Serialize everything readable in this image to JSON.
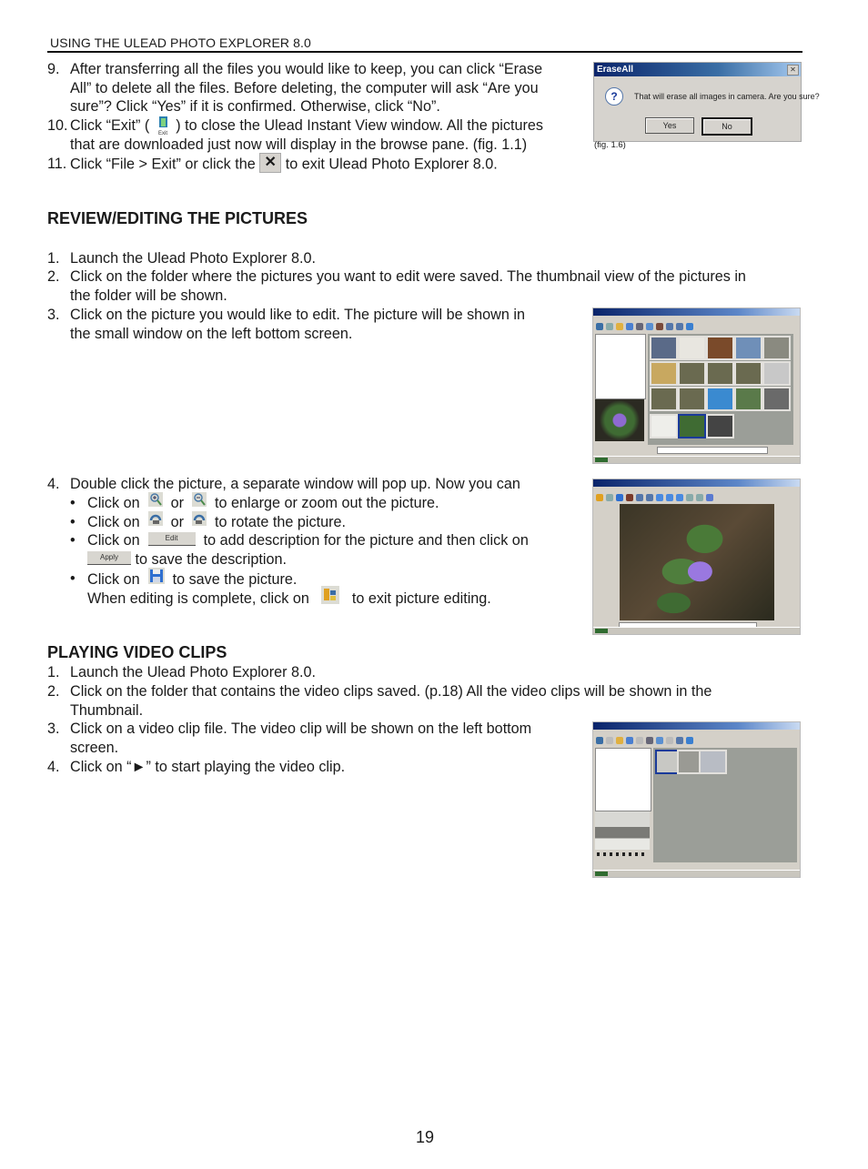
{
  "header": {
    "title": "USING THE ULEAD PHOTO EXPLORER 8.0"
  },
  "top_steps": [
    {
      "num": "9.",
      "lines": [
        "After transferring all the files you would like to keep, you can click “Erase",
        "All” to delete all the files. Before deleting, the computer will ask “Are you",
        "sure”?  Click “Yes” if it is confirmed. Otherwise, click “No”."
      ]
    },
    {
      "num": "10.",
      "line1_before": "Click “Exit” (",
      "line1_after": ") to close the Ulead Instant View window. All the pictures",
      "line2": "that are downloaded just now will display in the browse pane. (fig. 1.1)",
      "icon": "exit-icon",
      "icon_label": "Exit"
    },
    {
      "num": "11.",
      "before": "Click “File > Exit” or click the",
      "after": "to exit Ulead Photo Explorer 8.0.",
      "icon": "close-x-icon"
    }
  ],
  "erase_dialog": {
    "title": "EraseAll",
    "message": "That will erase all images in camera. Are you sure?",
    "yes_label": "Yes",
    "no_label": "No",
    "caption": "(fig. 1.6)"
  },
  "review_section": {
    "heading": "REVIEW/EDITING THE PICTURES",
    "steps": [
      {
        "num": "1.",
        "lines": [
          "Launch the Ulead Photo Explorer 8.0."
        ]
      },
      {
        "num": "2.",
        "lines": [
          "Click on the folder where the pictures you want to edit were saved. The thumbnail view of the pictures in",
          "the folder will be shown."
        ]
      },
      {
        "num": "3.",
        "lines": [
          "Click on the picture you would like to edit. The picture will be shown in",
          "the small window on the left bottom screen."
        ]
      },
      {
        "num": "4.",
        "lines": [
          "Double click the picture, a separate window will pop up. Now you can"
        ]
      }
    ],
    "bullets": [
      {
        "prefix": "Click on",
        "mid": "or",
        "suffix": "to enlarge or zoom out the picture.",
        "icons": [
          "zoom-in-icon",
          "zoom-out-icon"
        ]
      },
      {
        "prefix": "Click on",
        "mid": "or",
        "suffix": "to rotate the picture.",
        "icons": [
          "rotate-left-icon",
          "rotate-right-icon"
        ]
      },
      {
        "prefix": "Click on",
        "suffix": "to add description for the picture and then click on",
        "button": "Edit",
        "line2_button": "Apply",
        "line2": "to save the description."
      },
      {
        "prefix": "Click on",
        "suffix": "to save the picture.",
        "icons": [
          "save-icon"
        ]
      }
    ],
    "closing_before": "When editing is complete, click on",
    "closing_after": "to exit picture editing."
  },
  "video_section": {
    "heading": "PLAYING VIDEO CLIPS",
    "steps": [
      {
        "num": "1.",
        "lines": [
          "Launch the Ulead Photo Explorer 8.0."
        ]
      },
      {
        "num": "2.",
        "lines": [
          "Click on the folder that contains the video clips saved. (p.18) All the video clips will be shown in the",
          "Thumbnail."
        ]
      },
      {
        "num": "3.",
        "lines": [
          "Click on a video clip file. The video clip will be shown on the left bottom",
          "screen."
        ]
      },
      {
        "num": "4.",
        "lines": [
          "Click on “►” to start playing the video clip."
        ]
      }
    ]
  },
  "page_number": "19",
  "colors": {
    "title_bar": "#0a246a",
    "window_face": "#d4d0c8",
    "flower": "#8e6ad0",
    "leaf": "#3f6b33"
  }
}
